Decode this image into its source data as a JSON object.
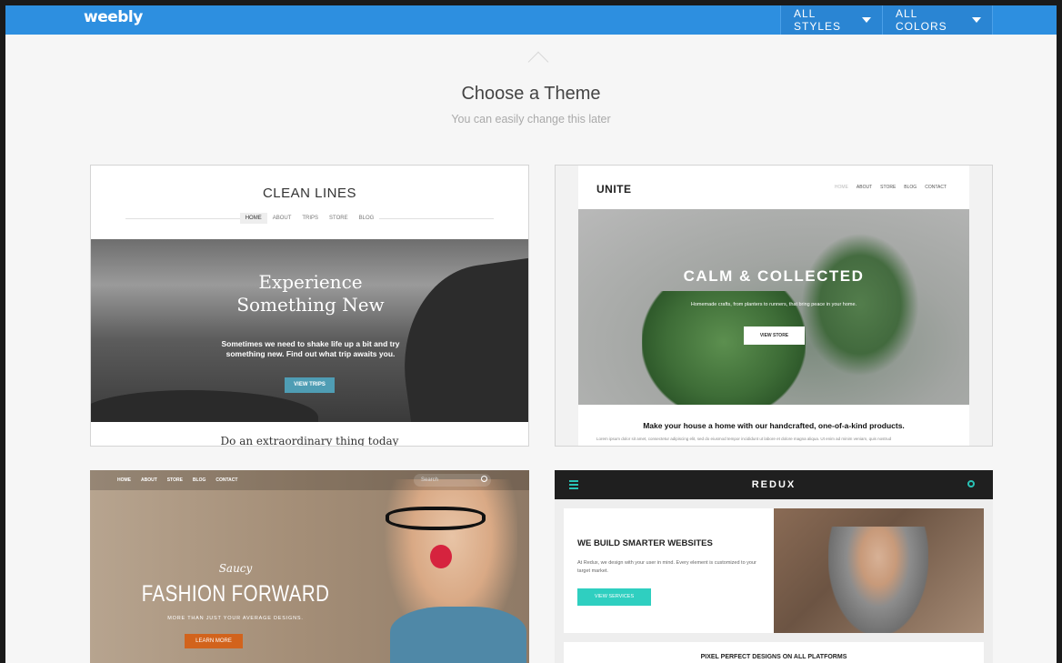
{
  "topbar": {
    "logo": "weebly",
    "filters": [
      {
        "label": "ALL STYLES"
      },
      {
        "label": "ALL COLORS"
      }
    ]
  },
  "header": {
    "title": "Choose a Theme",
    "subtitle": "You can easily change this later"
  },
  "themes": [
    {
      "name": "CLEAN LINES",
      "nav": [
        "HOME",
        "ABOUT",
        "TRIPS",
        "STORE",
        "BLOG"
      ],
      "headline_1": "Experience",
      "headline_2": "Something New",
      "blurb_1": "Sometimes we need to shake life up a bit and try",
      "blurb_2": "something new. Find out what trip awaits you.",
      "button": "VIEW TRIPS",
      "footer": "Do an extraordinary thing today"
    },
    {
      "name": "UNITE",
      "nav": [
        "HOME",
        "ABOUT",
        "STORE",
        "BLOG",
        "CONTACT"
      ],
      "headline": "CALM & COLLECTED",
      "blurb": "Homemade crafts, from planters to runners, that bring peace in your home.",
      "button": "VIEW STORE",
      "tagline": "Make your house a home with our handcrafted, one-of-a-kind products.",
      "lorem": "Lorem ipsum dolor sit amet, consectetur adipiscing elit, sed do eiusmod tempor incididunt ut labore et dolore magna aliqua. Ut enim ad minim veniam, quis nostrud"
    },
    {
      "nav": [
        "HOME",
        "ABOUT",
        "STORE",
        "BLOG",
        "CONTACT"
      ],
      "search_placeholder": "Search",
      "script": "Saucy",
      "headline": "FASHION FORWARD",
      "sub": "MORE THAN JUST YOUR AVERAGE DESIGNS.",
      "button": "LEARN MORE"
    },
    {
      "name": "REDUX",
      "heading": "WE BUILD SMARTER WEBSITES",
      "paragraph": "At Redux, we design with your user in mind. Every element is customized to your target market.",
      "button": "VIEW SERVICES",
      "strip": "PIXEL PERFECT DESIGNS ON ALL PLATFORMS"
    }
  ],
  "colors": {
    "topbar": "#2d8fe0",
    "redux_accent": "#29c2b5",
    "fashion_button": "#d2631c",
    "cleanlines_button": "#4f9db4"
  }
}
